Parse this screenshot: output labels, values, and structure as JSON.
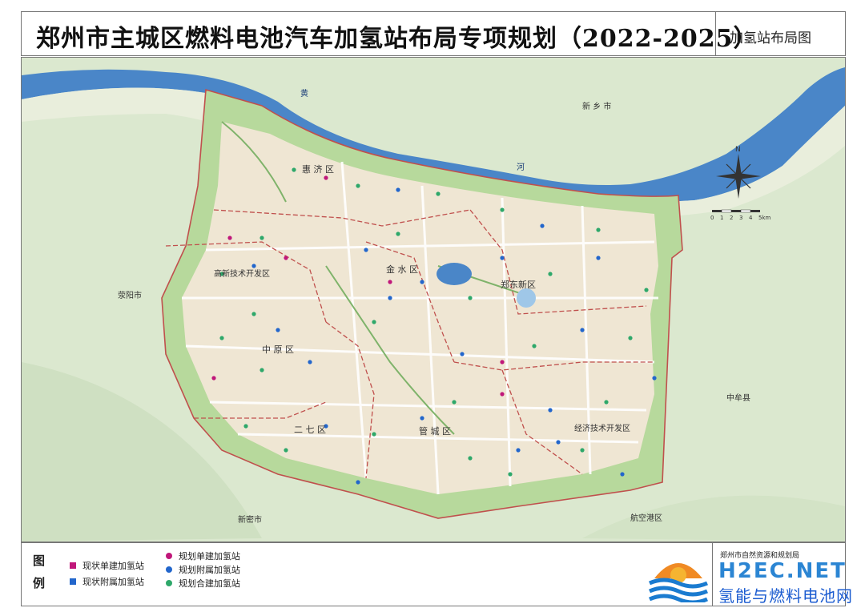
{
  "header": {
    "title": "郑州市主城区燃料电池汽车加氢站布局专项规划（2022-2025）",
    "map_name": "加氢站布局图"
  },
  "map": {
    "districts": {
      "huiji": "惠 济 区",
      "jinshui": "金 水 区",
      "gaoxin": "高新技术开发区",
      "zhengdong": "郑东新区",
      "zhongyuan": "中 原 区",
      "erqi": "二 七 区",
      "guancheng": "管 城 区",
      "jingkai": "经济技术开发区"
    },
    "places": {
      "xinxiang": "新 乡 市",
      "xingyang": "荥阳市",
      "zhongmou": "中牟县",
      "xinmi": "新密市",
      "hangkonggang": "航空港区"
    },
    "river": {
      "char1": "黄",
      "char2": "河"
    },
    "compass": {
      "label": "N"
    },
    "scale": {
      "ticks": [
        "0",
        "1",
        "2",
        "3",
        "4",
        "5km"
      ]
    }
  },
  "legend": {
    "title_line1": "图",
    "title_line2": "例",
    "items": [
      {
        "label": "现状单建加氢站",
        "color": "#c0177a"
      },
      {
        "label": "现状附属加氢站",
        "color": "#2266cc"
      },
      {
        "label": "规划单建加氢站",
        "color": "#c0177a"
      },
      {
        "label": "规划附属加氢站",
        "color": "#2266cc"
      },
      {
        "label": "规划合建加氢站",
        "color": "#2ea86a"
      }
    ],
    "agency": "郑州市自然资源和规划局"
  },
  "watermark": {
    "text": "H2EC.NET",
    "sub": "氢能与燃料电池网"
  },
  "colors": {
    "river": "#4a86c8",
    "urban": "#efe6d3",
    "green_belt": "#b7d99c",
    "boundary": "#c0504d",
    "base": "#dfead3"
  }
}
